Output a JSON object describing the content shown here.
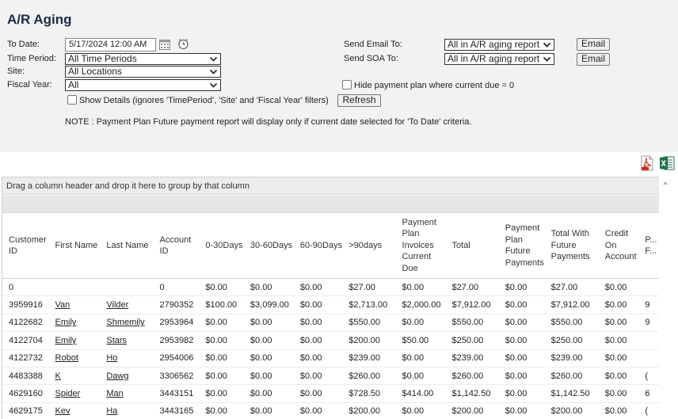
{
  "page": {
    "title": "A/R Aging"
  },
  "filters": {
    "to_date_label": "To Date:",
    "to_date_value": "5/17/2024 12:00 AM",
    "time_period_label": "Time Period:",
    "time_period_value": "All Time Periods",
    "site_label": "Site:",
    "site_value": "All Locations",
    "fiscal_year_label": "Fiscal Year:",
    "fiscal_year_value": "All",
    "show_details_label": "Show Details (ignores 'TimePeriod', 'Site' and 'Fiscal Year' filters)",
    "refresh_label": "Refresh",
    "note": "NOTE : Payment Plan Future payment report will display only if current date selected for 'To Date' criteria.",
    "send_email_label": "Send Email To:",
    "send_email_value": "All in A/R aging report",
    "send_soa_label": "Send SOA To:",
    "send_soa_value": "All in A/R aging report",
    "email_button_label": "Email",
    "email_button2_label": "Email",
    "hide_payment_plan_label": "Hide payment plan where current due = 0"
  },
  "export": {
    "pdf_icon": "pdf-icon",
    "excel_icon": "excel-icon"
  },
  "grid": {
    "group_hint": "Drag a column header and drop it here to group by that column",
    "columns": [
      "Customer ID",
      "First Name",
      "Last Name",
      "Account ID",
      "0-30Days",
      "30-60Days",
      "60-90Days",
      ">90days",
      "Payment Plan Invoices Current Due",
      "Total",
      "Payment Plan Future Payments",
      "Total With Future Payments",
      "Credit On Account",
      "P... F..."
    ],
    "rows": [
      [
        "0",
        "",
        "",
        "0",
        "$0.00",
        "$0.00",
        "$0.00",
        "$27.00",
        "$0.00",
        "$27.00",
        "$0.00",
        "$27.00",
        "$0.00",
        ""
      ],
      [
        "3959916",
        "Van",
        "Vilder",
        "2790352",
        "$100.00",
        "$3,099.00",
        "$0.00",
        "$2,713.00",
        "$2,000.00",
        "$7,912.00",
        "$0.00",
        "$7,912.00",
        "$0.00",
        "9"
      ],
      [
        "4122682",
        "Emily",
        "Shmemily",
        "2953964",
        "$0.00",
        "$0.00",
        "$0.00",
        "$550.00",
        "$0.00",
        "$550.00",
        "$0.00",
        "$550.00",
        "$0.00",
        "9"
      ],
      [
        "4122704",
        "Emily",
        "Stars",
        "2953982",
        "$0.00",
        "$0.00",
        "$0.00",
        "$200.00",
        "$50.00",
        "$250.00",
        "$0.00",
        "$250.00",
        "$0.00",
        ""
      ],
      [
        "4122732",
        "Robot",
        "Ho",
        "2954006",
        "$0.00",
        "$0.00",
        "$0.00",
        "$239.00",
        "$0.00",
        "$239.00",
        "$0.00",
        "$239.00",
        "$0.00",
        ""
      ],
      [
        "4483388",
        "K",
        "Dawg",
        "3306562",
        "$0.00",
        "$0.00",
        "$0.00",
        "$260.00",
        "$0.00",
        "$260.00",
        "$0.00",
        "$260.00",
        "$0.00",
        "("
      ],
      [
        "4629160",
        "Spider",
        "Man",
        "3443151",
        "$0.00",
        "$0.00",
        "$0.00",
        "$728.50",
        "$414.00",
        "$1,142.50",
        "$0.00",
        "$1,142.50",
        "$0.00",
        "6"
      ],
      [
        "4629175",
        "Kev",
        "Ha",
        "3443165",
        "$0.00",
        "$0.00",
        "$0.00",
        "$200.00",
        "$0.00",
        "$200.00",
        "$0.00",
        "$200.00",
        "$0.00",
        "("
      ]
    ]
  }
}
